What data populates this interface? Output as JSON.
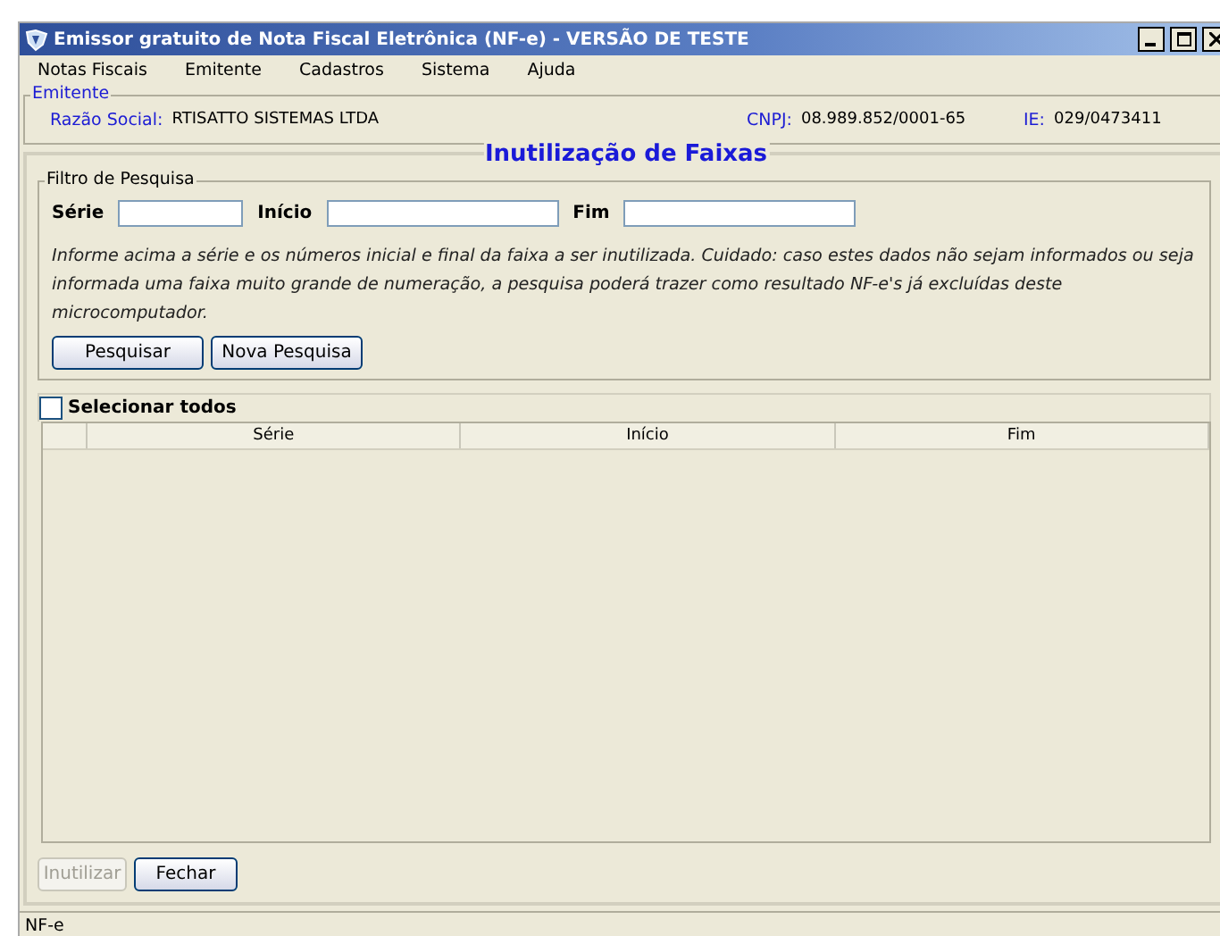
{
  "window": {
    "title": "Emissor gratuito de Nota Fiscal Eletrônica (NF-e) - VERSÃO DE TESTE"
  },
  "menu": [
    "Notas Fiscais",
    "Emitente",
    "Cadastros",
    "Sistema",
    "Ajuda"
  ],
  "emitente": {
    "legend": "Emitente",
    "fields": [
      {
        "label": "Razão Social:",
        "value": "RTISATTO SISTEMAS LTDA"
      },
      {
        "label": "CNPJ:",
        "value": "08.989.852/0001-65"
      },
      {
        "label": "IE:",
        "value": "029/0473411"
      }
    ]
  },
  "panel": {
    "title": "Inutilização de Faixas",
    "filter": {
      "legend": "Filtro de Pesquisa",
      "fields": [
        {
          "label": "Série"
        },
        {
          "label": "Início"
        },
        {
          "label": "Fim"
        }
      ],
      "note": "Informe acima a série e os números inicial e final da faixa a ser inutilizada. Cuidado: caso estes dados não sejam informados ou seja informada uma faixa muito grande de numeração, a pesquisa poderá trazer como resultado NF-e's já excluídas deste microcomputador.",
      "buttons": [
        {
          "label": "Pesquisar",
          "disabled": false
        },
        {
          "label": "Nova Pesquisa",
          "disabled": false
        }
      ]
    },
    "select_all": {
      "label": "Selecionar todos",
      "checked": false
    },
    "table": {
      "columns": [
        "Série",
        "Início",
        "Fim"
      ]
    },
    "buttons": [
      {
        "label": "Inutilizar",
        "disabled": true
      },
      {
        "label": "Fechar",
        "disabled": false
      }
    ]
  },
  "status_bar": "NF-e"
}
